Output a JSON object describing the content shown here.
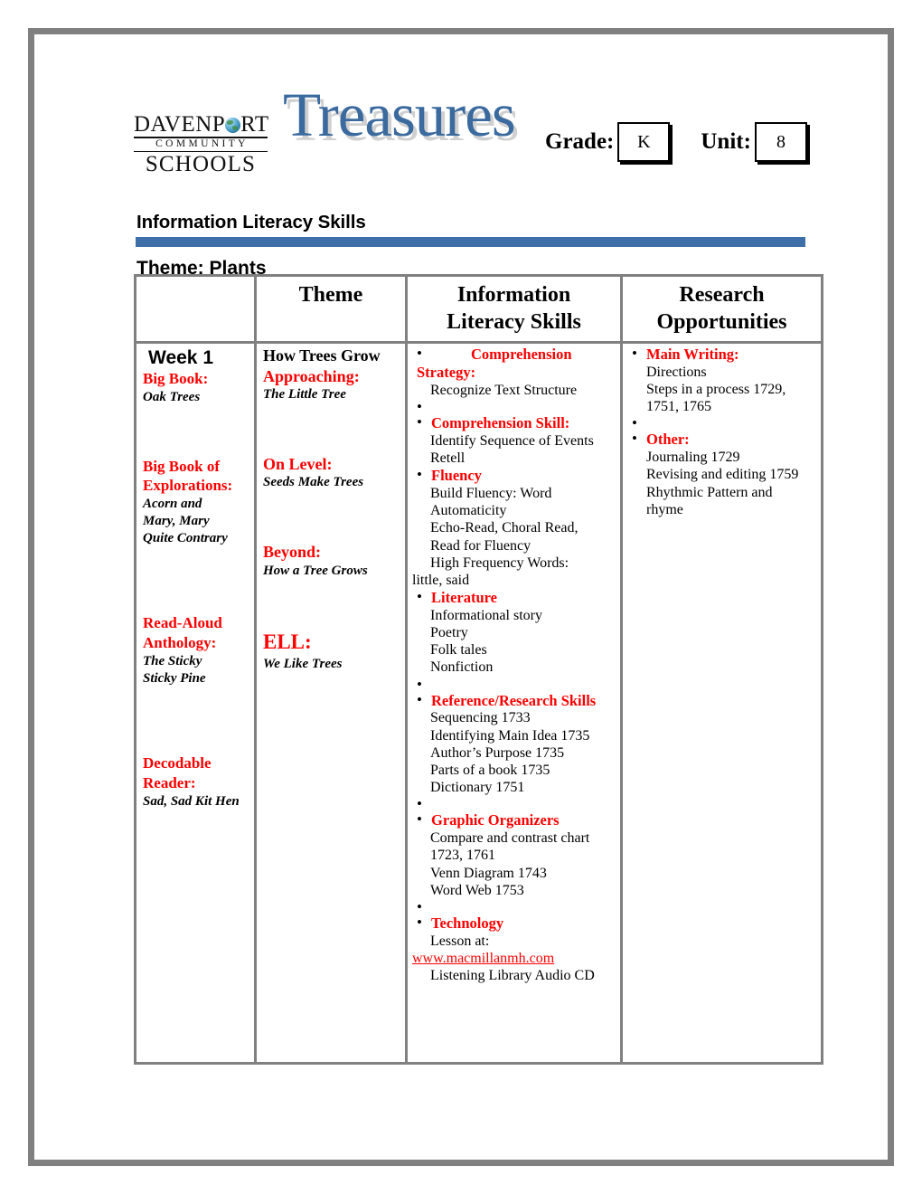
{
  "document": {
    "logo": {
      "line1": "DAVENP",
      "line1_end": "RT",
      "line2": "COMMUNITY",
      "line3": "SCHOOLS",
      "globe_icon": "globe-icon"
    },
    "wordmark": "Treasures",
    "grade": {
      "label": "Grade:",
      "value": "K"
    },
    "unit": {
      "label": "Unit:",
      "value": "8"
    },
    "heading": "Information Literacy Skills",
    "theme_heading": "Theme: Plants",
    "accent_blue": "#3e6fa8",
    "accent_red": "#ff0000",
    "border_gray": "#808080"
  },
  "table": {
    "headers": [
      "",
      "Theme",
      "Information Literacy Skills",
      "Research Opportunities"
    ],
    "header_line1": [
      "",
      "Theme",
      "Information",
      "Research"
    ],
    "header_line2": [
      "",
      "",
      "Literacy Skills",
      "Opportunities"
    ],
    "col1": {
      "week": "Week 1",
      "groups": [
        {
          "label": "Big Book:",
          "titles": [
            "Oak Trees"
          ]
        },
        {
          "label": "Big Book of Explorations:",
          "titles": [
            "Acorn and",
            "Mary, Mary",
            "Quite Contrary"
          ]
        },
        {
          "label": "Read-Aloud Anthology:",
          "titles": [
            "The Sticky",
            "Sticky Pine"
          ]
        },
        {
          "label": "Decodable Reader:",
          "titles": [
            "Sad, Sad Kit Hen"
          ]
        }
      ]
    },
    "col2": {
      "top_title": "How Trees Grow",
      "groups": [
        {
          "label": "Approaching:",
          "title": "The Little Tree"
        },
        {
          "label": "On Level:",
          "title": "Seeds Make Trees"
        },
        {
          "label": "Beyond:",
          "title": "How a Tree Grows"
        },
        {
          "label": "ELL:",
          "title": "We Like Trees"
        }
      ]
    },
    "col3": {
      "sections": [
        {
          "head": "Comprehension",
          "head2": "Strategy:",
          "items": [
            "Recognize Text Structure"
          ]
        },
        {
          "head": "Comprehension Skill:",
          "items": [
            "Identify Sequence of Events",
            "Retell"
          ]
        },
        {
          "head": "Fluency",
          "items": [
            "Build Fluency: Word",
            "Automaticity",
            "Echo-Read, Choral Read,",
            "Read for Fluency",
            "High Frequency Words:",
            "little, said"
          ]
        },
        {
          "head": "Literature",
          "items": [
            "Informational story",
            "Poetry",
            "Folk tales",
            "Nonfiction"
          ]
        },
        {
          "head": "Reference/Research Skills",
          "items": [
            "Sequencing  1733",
            "Identifying Main Idea 1735",
            "Author’s Purpose  1735",
            "Parts of a book  1735",
            "Dictionary  1751"
          ]
        },
        {
          "head": "Graphic Organizers",
          "items": [
            "Compare and contrast chart",
            "1723, 1761",
            "Venn Diagram 1743",
            "Word Web 1753"
          ]
        },
        {
          "head": "Technology",
          "items": [
            "Lesson at:"
          ],
          "link": "www.macmillanmh.com",
          "items_after": [
            "Listening Library Audio CD"
          ]
        }
      ]
    },
    "col4": {
      "sections": [
        {
          "head": "Main Writing:",
          "items": [
            "Directions",
            "Steps in a process  1729,",
            "1751, 1765"
          ]
        },
        {
          "head": "Other:",
          "items": [
            "Journaling 1729",
            "Revising and editing 1759",
            "Rhythmic Pattern and",
            "rhyme"
          ]
        }
      ]
    }
  }
}
